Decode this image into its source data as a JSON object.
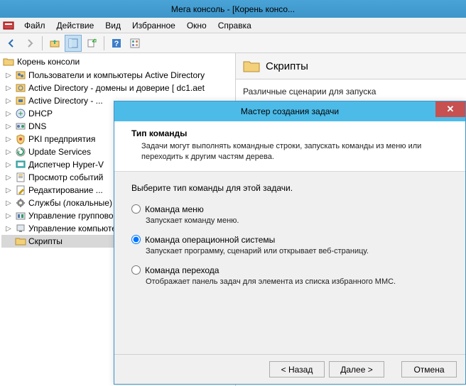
{
  "titlebar": {
    "text": "Мега консоль - [Корень консо..."
  },
  "menu": {
    "items": [
      "Файл",
      "Действие",
      "Вид",
      "Избранное",
      "Окно",
      "Справка"
    ]
  },
  "tree": {
    "root": "Корень консоли",
    "items": [
      {
        "label": "Пользователи и компьютеры Active Directory",
        "icon": "ad-users"
      },
      {
        "label": "Active Directory - домены и доверие [ dc1.aet",
        "icon": "ad-domains"
      },
      {
        "label": "Active Directory - ...",
        "icon": "ad-sites"
      },
      {
        "label": "DHCP",
        "icon": "dhcp"
      },
      {
        "label": "DNS",
        "icon": "dns"
      },
      {
        "label": "PKI предприятия",
        "icon": "pki"
      },
      {
        "label": "Update Services",
        "icon": "updates"
      },
      {
        "label": "Диспетчер Hyper-V",
        "icon": "hyperv"
      },
      {
        "label": "Просмотр событий",
        "icon": "events"
      },
      {
        "label": "Редактирование ...",
        "icon": "gpo-edit"
      },
      {
        "label": "Службы (локальные)",
        "icon": "services"
      },
      {
        "label": "Управление групповой политикой",
        "icon": "gpo-mgmt"
      },
      {
        "label": "Управление компьютером",
        "icon": "computer-mgmt"
      },
      {
        "label": "Скрипты",
        "icon": "folder",
        "selected": true,
        "noexpand": true
      }
    ]
  },
  "right": {
    "title": "Скрипты",
    "description": "Различные сценарии для запуска"
  },
  "dialog": {
    "title": "Мастер создания задачи",
    "header_title": "Тип команды",
    "header_desc": "Задачи могут выполнять командные строки, запускать команды из меню или переходить к другим частям дерева.",
    "prompt": "Выберите тип команды для этой задачи.",
    "options": [
      {
        "label": "Команда меню",
        "desc": "Запускает команду меню.",
        "checked": false
      },
      {
        "label": "Команда операционной системы",
        "desc": "Запускает программу, сценарий или открывает веб-страницу.",
        "checked": true
      },
      {
        "label": "Команда перехода",
        "desc": "Отображает панель задач для элемента из списка избранного MMC.",
        "checked": false
      }
    ],
    "buttons": {
      "back": "< Назад",
      "next": "Далее >",
      "cancel": "Отмена"
    }
  }
}
